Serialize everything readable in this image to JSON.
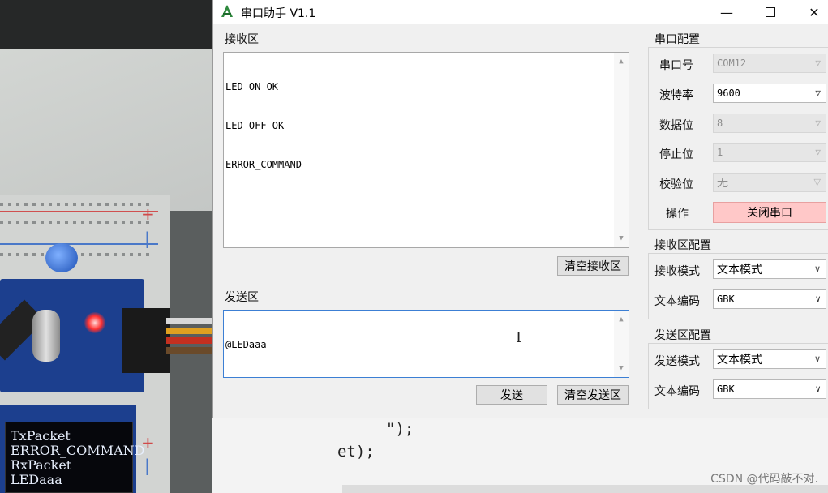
{
  "window": {
    "title": "串口助手 V1.1",
    "minimize_glyph": "—",
    "close_glyph": "✕"
  },
  "receive": {
    "label": "接收区",
    "lines": [
      "LED_ON_OK",
      "LED_OFF_OK",
      "ERROR_COMMAND"
    ],
    "clear_button": "清空接收区"
  },
  "send": {
    "label": "发送区",
    "lines": [
      "@LEDaaa",
      "|"
    ],
    "send_button": "发送",
    "clear_button": "清空发送区"
  },
  "serial_config": {
    "label": "串口配置",
    "rows": [
      {
        "label": "串口号",
        "value": "COM12"
      },
      {
        "label": "波特率",
        "value": "9600"
      },
      {
        "label": "数据位",
        "value": "8"
      },
      {
        "label": "停止位",
        "value": "1"
      },
      {
        "label": "校验位",
        "value": "无"
      }
    ],
    "operation_label": "操作",
    "operation_button": "关闭串口"
  },
  "receive_config": {
    "label": "接收区配置",
    "mode_label": "接收模式",
    "mode_value": "文本模式",
    "encoding_label": "文本编码",
    "encoding_value": "GBK"
  },
  "send_config": {
    "label": "发送区配置",
    "mode_label": "发送模式",
    "mode_value": "文本模式",
    "encoding_label": "文本编码",
    "encoding_value": "GBK"
  },
  "background": {
    "oled_lines": [
      "TxPacket",
      "ERROR_COMMAND",
      "RxPacket",
      "LEDaaa"
    ],
    "code_line_1": "\");",
    "code_line_2": "et);",
    "watermark": "CSDN @代码敲不对."
  },
  "colors": {
    "accent_focus": "#3c7fd4",
    "close_port_button": "#ffc8c8",
    "window_bg": "#f0f0f0"
  },
  "icons": {
    "app": "green-a-logo-icon",
    "scroll_up": "chevron-up-icon",
    "scroll_down": "chevron-down-icon",
    "combo_arrow": "chevron-down-icon"
  }
}
